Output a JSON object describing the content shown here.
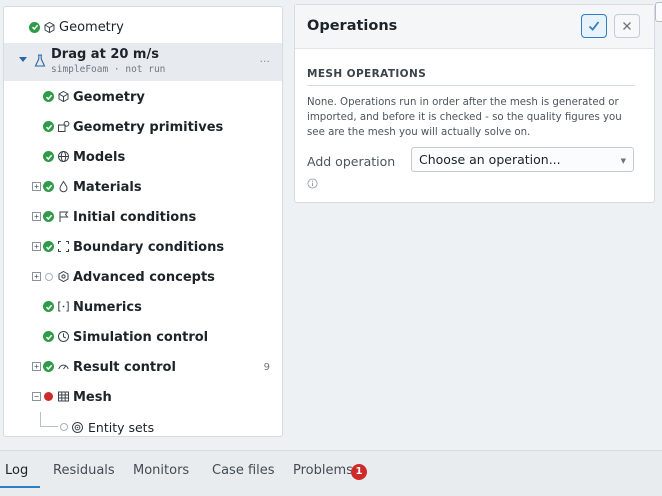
{
  "tree": {
    "top_item": {
      "label": "Geometry"
    },
    "case": {
      "title": "Drag at 20 m/s",
      "subtitle": "simpleFoam · not run",
      "more": "···"
    },
    "items": [
      {
        "label": "Geometry",
        "icon": "cube-icon",
        "status": "ok",
        "toggle": ""
      },
      {
        "label": "Geometry primitives",
        "icon": "shapes-icon",
        "status": "ok",
        "toggle": ""
      },
      {
        "label": "Models",
        "icon": "globe-icon",
        "status": "ok",
        "toggle": ""
      },
      {
        "label": "Materials",
        "icon": "drop-icon",
        "status": "ok",
        "toggle": "+"
      },
      {
        "label": "Initial conditions",
        "icon": "flag-icon",
        "status": "ok",
        "toggle": "+"
      },
      {
        "label": "Boundary conditions",
        "icon": "boundary-icon",
        "status": "ok",
        "toggle": "+"
      },
      {
        "label": "Advanced concepts",
        "icon": "hexagon-icon",
        "status": "none",
        "toggle": "+"
      },
      {
        "label": "Numerics",
        "icon": "numerics-icon",
        "status": "ok",
        "toggle": ""
      },
      {
        "label": "Simulation control",
        "icon": "clock-icon",
        "status": "ok",
        "toggle": ""
      },
      {
        "label": "Result control",
        "icon": "gauge-icon",
        "status": "ok",
        "toggle": "+",
        "count": "9"
      },
      {
        "label": "Mesh",
        "icon": "grid-icon",
        "status": "error",
        "toggle": "−"
      }
    ],
    "sub_item": {
      "label": "Entity sets",
      "icon": "target-icon"
    }
  },
  "operations": {
    "title": "Operations",
    "section_title": "MESH OPERATIONS",
    "description": "None. Operations run in order after the mesh is generated or imported, and before it is checked - so the quality figures you see are the mesh you will actually solve on.",
    "add_label": "Add operation",
    "select_value": "Choose an operation..."
  },
  "bottom_tabs": {
    "items": [
      "Log",
      "Residuals",
      "Monitors",
      "Case files",
      "Problems"
    ],
    "problems_count": "1"
  },
  "colors": {
    "accent": "#2f7ec1",
    "ok": "#2f9a48",
    "error": "#cf2a2a"
  }
}
